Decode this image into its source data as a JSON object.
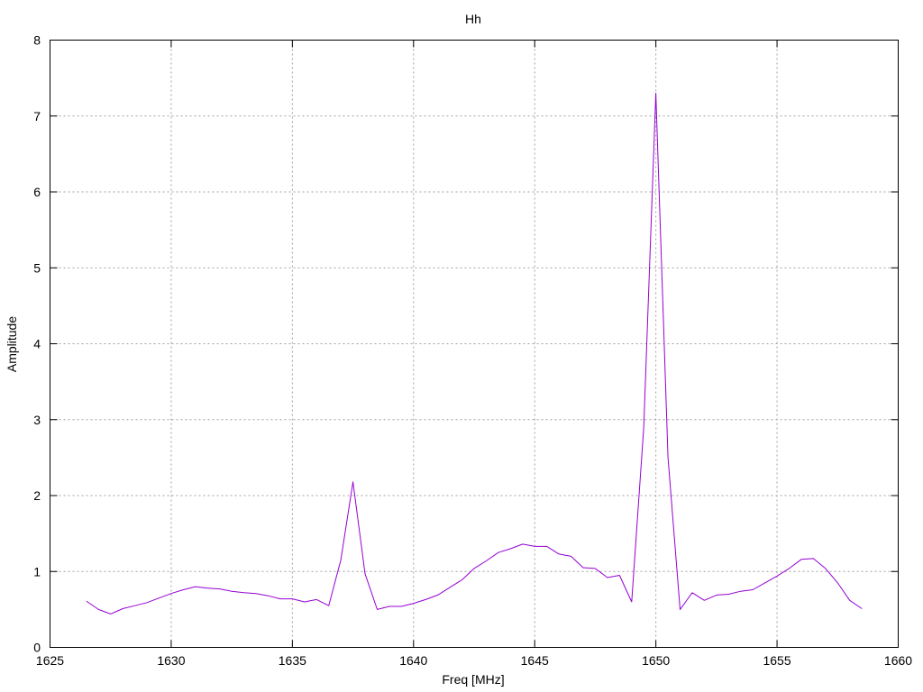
{
  "chart_data": {
    "type": "line",
    "title": "Hh",
    "xlabel": "Freq [MHz]",
    "ylabel": "Amplitude",
    "xlim": [
      1625,
      1660
    ],
    "ylim": [
      0,
      8
    ],
    "xticks": [
      1625,
      1630,
      1635,
      1640,
      1645,
      1650,
      1655,
      1660
    ],
    "yticks": [
      0,
      1,
      2,
      3,
      4,
      5,
      6,
      7,
      8
    ],
    "grid": true,
    "colors": {
      "series": "#9400d3",
      "grid": "#a0a0a0",
      "axis": "#000000"
    },
    "series": [
      {
        "x": [
          1626.5,
          1627.0,
          1627.5,
          1628.0,
          1628.5,
          1629.0,
          1629.5,
          1630.0,
          1630.5,
          1631.0,
          1631.5,
          1632.0,
          1632.5,
          1633.0,
          1633.5,
          1634.0,
          1634.5,
          1635.0,
          1635.5,
          1636.0,
          1636.5,
          1637.0,
          1637.5,
          1638.0,
          1638.5,
          1639.0,
          1639.5,
          1640.0,
          1640.5,
          1641.0,
          1641.5,
          1642.0,
          1642.5,
          1643.0,
          1643.5,
          1644.0,
          1644.5,
          1645.0,
          1645.5,
          1646.0,
          1646.5,
          1647.0,
          1647.5,
          1648.0,
          1648.5,
          1649.0,
          1649.5,
          1650.0,
          1650.5,
          1651.0,
          1651.5,
          1652.0,
          1652.5,
          1653.0,
          1653.5,
          1654.0,
          1654.5,
          1655.0,
          1655.5,
          1656.0,
          1656.5,
          1657.0,
          1657.5,
          1658.0,
          1658.5
        ],
        "y": [
          0.61,
          0.5,
          0.44,
          0.51,
          0.55,
          0.59,
          0.65,
          0.71,
          0.76,
          0.8,
          0.78,
          0.77,
          0.74,
          0.72,
          0.71,
          0.68,
          0.64,
          0.64,
          0.6,
          0.63,
          0.55,
          1.15,
          2.18,
          0.97,
          0.5,
          0.54,
          0.54,
          0.58,
          0.63,
          0.69,
          0.79,
          0.89,
          1.04,
          1.14,
          1.25,
          1.3,
          1.36,
          1.33,
          1.33,
          1.23,
          1.2,
          1.05,
          1.04,
          0.92,
          0.95,
          0.6,
          2.9,
          7.3,
          2.5,
          0.5,
          0.72,
          0.62,
          0.69,
          0.7,
          0.74,
          0.76,
          0.85,
          0.94,
          1.04,
          1.16,
          1.17,
          1.04,
          0.85,
          0.62,
          0.51
        ]
      }
    ]
  }
}
